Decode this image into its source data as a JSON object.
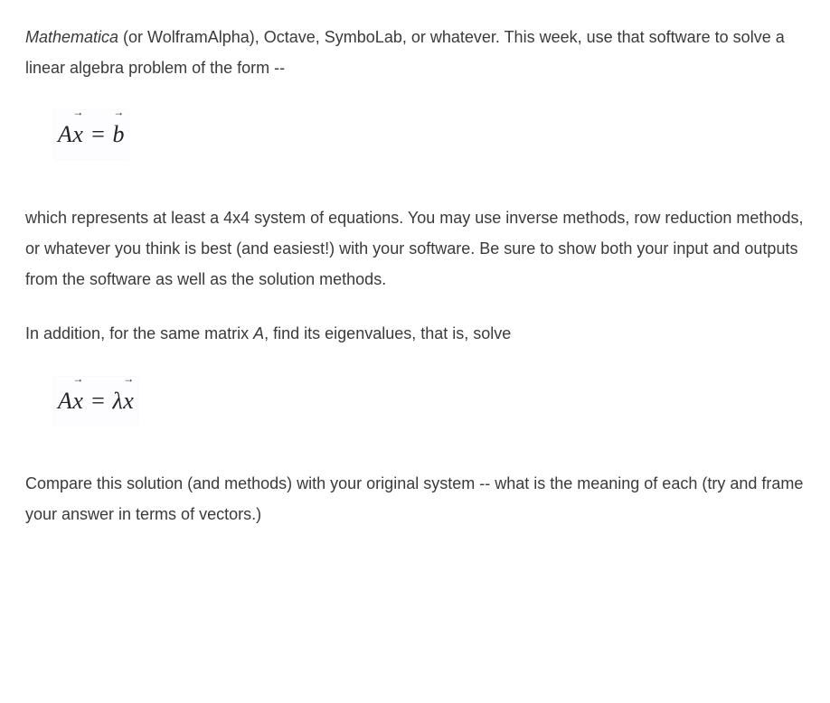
{
  "paragraphs": {
    "p1": {
      "italic_lead": "Mathematica",
      "rest": " (or WolframAlpha), Octave, SymboLab, or whatever. This week, use that software to solve a linear algebra problem of the form --"
    },
    "eq1": {
      "A": "A",
      "x": "x",
      "eq": " = ",
      "b": "b"
    },
    "p2": "which represents at least a 4x4 system of equations. You may use inverse methods, row reduction methods, or whatever you think is best (and easiest!) with your software. Be sure to show both your input and outputs from the software as well as the solution methods.",
    "p3": {
      "before": "In addition, for the same matrix ",
      "A": "A",
      "after": ", find its eigenvalues, that is, solve"
    },
    "eq2": {
      "A": "A",
      "x1": "x",
      "eq": " = ",
      "lambda": "λ",
      "x2": "x"
    },
    "p4": "Compare this solution (and methods) with your original system -- what is the meaning of each (try and frame your answer in terms of vectors.)"
  }
}
